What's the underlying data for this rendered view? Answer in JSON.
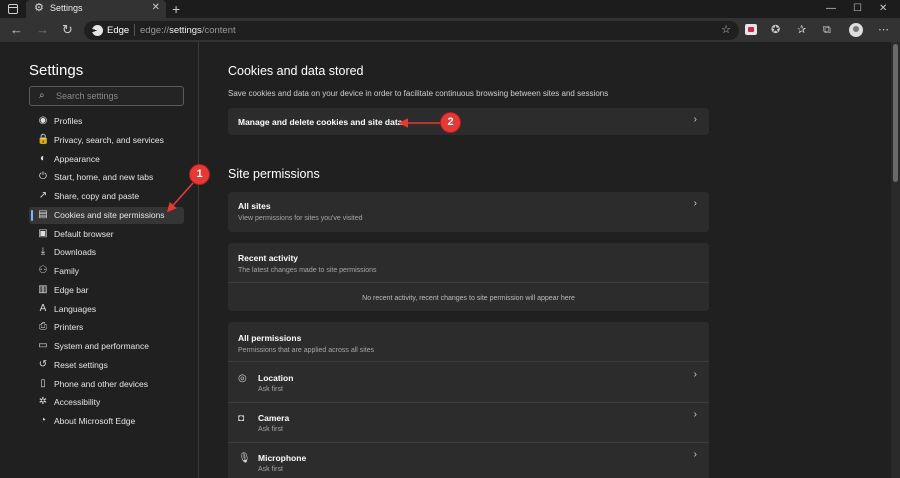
{
  "browser": {
    "tab_title": "Settings",
    "tab_close": "✕",
    "new_tab": "+",
    "address_brand": "Edge",
    "address_separator": "|",
    "url_prefix": "edge://",
    "url_host": "settings",
    "url_path": "/content",
    "window_controls": [
      "—",
      "☐",
      "✕"
    ],
    "toolbar_icons": [
      "reading-view-icon",
      "extension-icon",
      "refresh-circle-icon",
      "favorites-icon",
      "collections-icon",
      "profile-avatar",
      "more-icon"
    ]
  },
  "sidebar": {
    "title": "Settings",
    "search_placeholder": "Search settings",
    "items": [
      {
        "label": "Profiles",
        "icon": "profile-icon",
        "glyph": "◉"
      },
      {
        "label": "Privacy, search, and services",
        "icon": "lock-icon",
        "glyph": "🔒"
      },
      {
        "label": "Appearance",
        "icon": "appearance-icon",
        "glyph": "◐"
      },
      {
        "label": "Start, home, and new tabs",
        "icon": "power-icon",
        "glyph": "⏻"
      },
      {
        "label": "Share, copy and paste",
        "icon": "share-icon",
        "glyph": "↗"
      },
      {
        "label": "Cookies and site permissions",
        "icon": "cookies-icon",
        "glyph": "▤",
        "active": true
      },
      {
        "label": "Default browser",
        "icon": "browser-icon",
        "glyph": "▣"
      },
      {
        "label": "Downloads",
        "icon": "download-icon",
        "glyph": "⤓"
      },
      {
        "label": "Family",
        "icon": "family-icon",
        "glyph": "⚇"
      },
      {
        "label": "Edge bar",
        "icon": "edge-bar-icon",
        "glyph": "▥"
      },
      {
        "label": "Languages",
        "icon": "languages-icon",
        "glyph": "A"
      },
      {
        "label": "Printers",
        "icon": "printer-icon",
        "glyph": "⎙"
      },
      {
        "label": "System and performance",
        "icon": "system-icon",
        "glyph": "▭"
      },
      {
        "label": "Reset settings",
        "icon": "reset-icon",
        "glyph": "↺"
      },
      {
        "label": "Phone and other devices",
        "icon": "phone-icon",
        "glyph": "▯"
      },
      {
        "label": "Accessibility",
        "icon": "accessibility-icon",
        "glyph": "✲"
      },
      {
        "label": "About Microsoft Edge",
        "icon": "edge-logo-icon",
        "glyph": "◔"
      }
    ]
  },
  "main": {
    "cookies_heading": "Cookies and data stored",
    "cookies_desc": "Save cookies and data on your device in order to facilitate continuous browsing between sites and sessions",
    "manage_label": "Manage and delete cookies and site data",
    "permissions_heading": "Site permissions",
    "all_sites": {
      "title": "All sites",
      "subtitle": "View permissions for sites you've visited"
    },
    "recent_activity": {
      "title": "Recent activity",
      "subtitle": "The latest changes made to site permissions",
      "empty": "No recent activity, recent changes to site permission will appear here"
    },
    "all_permissions": {
      "title": "All permissions",
      "subtitle": "Permissions that are applied across all sites",
      "items": [
        {
          "title": "Location",
          "subtitle": "Ask first",
          "icon": "location-icon",
          "glyph": "◎"
        },
        {
          "title": "Camera",
          "subtitle": "Ask first",
          "icon": "camera-icon",
          "glyph": "◘"
        },
        {
          "title": "Microphone",
          "subtitle": "Ask first",
          "icon": "microphone-icon",
          "glyph": "🎙"
        }
      ]
    },
    "chevron": "›"
  },
  "annotations": {
    "badge_1": "1",
    "badge_2": "2",
    "color": "#e53935"
  }
}
